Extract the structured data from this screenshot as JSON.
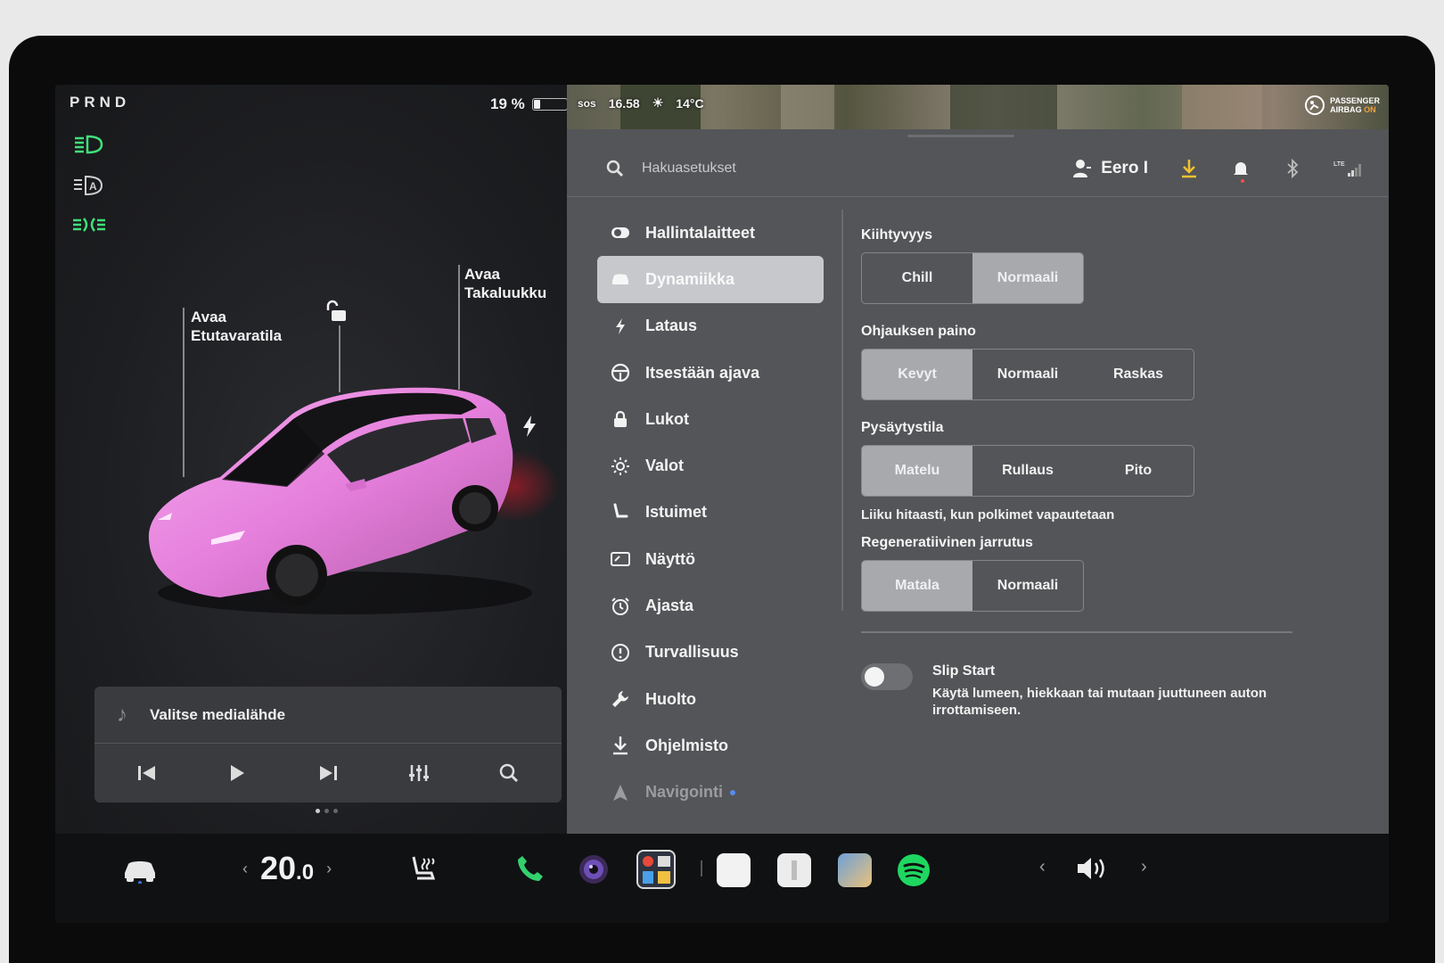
{
  "left": {
    "prnd": "PRND",
    "battery_percent": "19 %",
    "battery_level": 0.19,
    "callouts": {
      "frunk_line1": "Avaa",
      "frunk_line2": "Etutavaratila",
      "trunk_line1": "Avaa",
      "trunk_line2": "Takaluukku"
    },
    "icons": [
      "headlight-icon",
      "auto-headlight-icon",
      "parking-light-icon",
      "unlock-icon",
      "charge-port-bolt-icon"
    ],
    "car_color": "#e98fe0"
  },
  "media": {
    "title": "Valitse medialähde"
  },
  "status": {
    "sos": "sos",
    "time": "16.58",
    "temp": "14°C",
    "airbag_line1": "PASSENGER",
    "airbag_line2": "AIRBAG",
    "airbag_state": "ON"
  },
  "topbar": {
    "search_placeholder": "Hakuasetukset",
    "user_name": "Eero I",
    "network": "LTE"
  },
  "menu": {
    "items": [
      {
        "label": "Hallintalaitteet",
        "icon": "toggle-icon"
      },
      {
        "label": "Dynamiikka",
        "icon": "car-icon"
      },
      {
        "label": "Lataus",
        "icon": "bolt-icon"
      },
      {
        "label": "Itsestään ajava",
        "icon": "steering-wheel-icon"
      },
      {
        "label": "Lukot",
        "icon": "lock-icon"
      },
      {
        "label": "Valot",
        "icon": "sun-icon"
      },
      {
        "label": "Istuimet",
        "icon": "seat-icon"
      },
      {
        "label": "Näyttö",
        "icon": "display-icon"
      },
      {
        "label": "Ajasta",
        "icon": "alarm-clock-icon"
      },
      {
        "label": "Turvallisuus",
        "icon": "info-circle-icon"
      },
      {
        "label": "Huolto",
        "icon": "wrench-icon"
      },
      {
        "label": "Ohjelmisto",
        "icon": "download-icon"
      },
      {
        "label": "Navigointi",
        "icon": "navigation-icon"
      }
    ],
    "active_index": 1
  },
  "settings": {
    "acceleration": {
      "title": "Kiihtyvyys",
      "options": [
        "Chill",
        "Normaali"
      ],
      "selected": 1
    },
    "steering": {
      "title": "Ohjauksen paino",
      "options": [
        "Kevyt",
        "Normaali",
        "Raskas"
      ],
      "selected": 0
    },
    "stopping": {
      "title": "Pysäytystila",
      "options": [
        "Matelu",
        "Rullaus",
        "Pito"
      ],
      "selected": 0,
      "description": "Liiku hitaasti, kun polkimet vapautetaan"
    },
    "regen": {
      "title": "Regeneratiivinen jarrutus",
      "options": [
        "Matala",
        "Normaali"
      ],
      "selected": 0
    },
    "slip_start": {
      "title": "Slip Start",
      "description": "Käytä lumeen, hiekkaan tai mutaan juuttuneen auton irrottamiseen.",
      "enabled": false
    }
  },
  "dock": {
    "temp_whole": "20",
    "temp_decimal": ".0",
    "prev": "‹",
    "next": "›",
    "vol_prev": "‹",
    "vol_next": "›"
  }
}
